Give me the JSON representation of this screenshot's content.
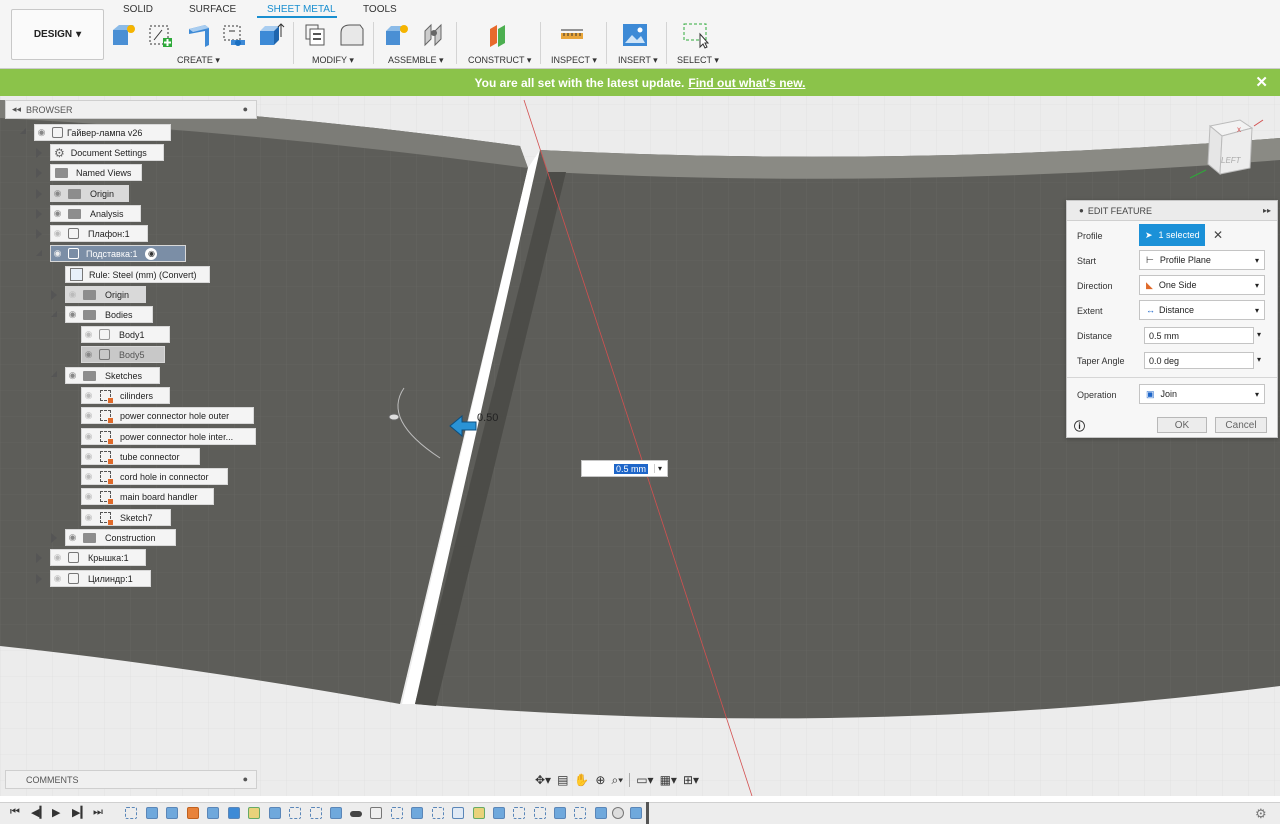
{
  "toolbar": {
    "workspace": "DESIGN",
    "tabs": [
      "SOLID",
      "SURFACE",
      "SHEET METAL",
      "TOOLS"
    ],
    "active_tab": "SHEET METAL",
    "groups": [
      "CREATE ▾",
      "MODIFY ▾",
      "ASSEMBLE ▾",
      "CONSTRUCT ▾",
      "INSPECT ▾",
      "INSERT ▾",
      "SELECT ▾"
    ]
  },
  "banner": {
    "message": "You are all set with the latest update.",
    "link": "Find out what's new.",
    "close": "✕"
  },
  "browser": {
    "title": "BROWSER",
    "nodes": [
      "Гайвер-лампа v26",
      "Document Settings",
      "Named Views",
      "Origin",
      "Analysis",
      "Плафон:1",
      "Подставка:1",
      "Rule: Steel (mm) (Convert)",
      "Origin",
      "Bodies",
      "Body1",
      "Body5",
      "Sketches",
      "cilinders",
      "power connector hole outer",
      "power connector hole inter...",
      "tube connector",
      "cord hole in connector",
      "main board handler",
      "Sketch7",
      "Construction",
      "Крышка:1",
      "Цилиндр:1"
    ]
  },
  "viewport": {
    "dimension_value": "0.5 mm",
    "dimension_label": "0.50",
    "viewcube_face": "LEFT"
  },
  "edit_feature": {
    "title": "EDIT FEATURE",
    "labels": [
      "Profile",
      "Start",
      "Direction",
      "Extent",
      "Distance",
      "Taper Angle",
      "Operation"
    ],
    "profile_value": "1 selected",
    "start_value": "Profile Plane",
    "direction_value": "One Side",
    "extent_value": "Distance",
    "distance_value": "0.5 mm",
    "taper_value": "0.0 deg",
    "operation_value": "Join",
    "ok": "OK",
    "cancel": "Cancel"
  },
  "comments": {
    "title": "COMMENTS"
  },
  "colors": {
    "accent": "#1a8fd0",
    "banner": "#8bc34a",
    "plate": "#5c5c58"
  }
}
